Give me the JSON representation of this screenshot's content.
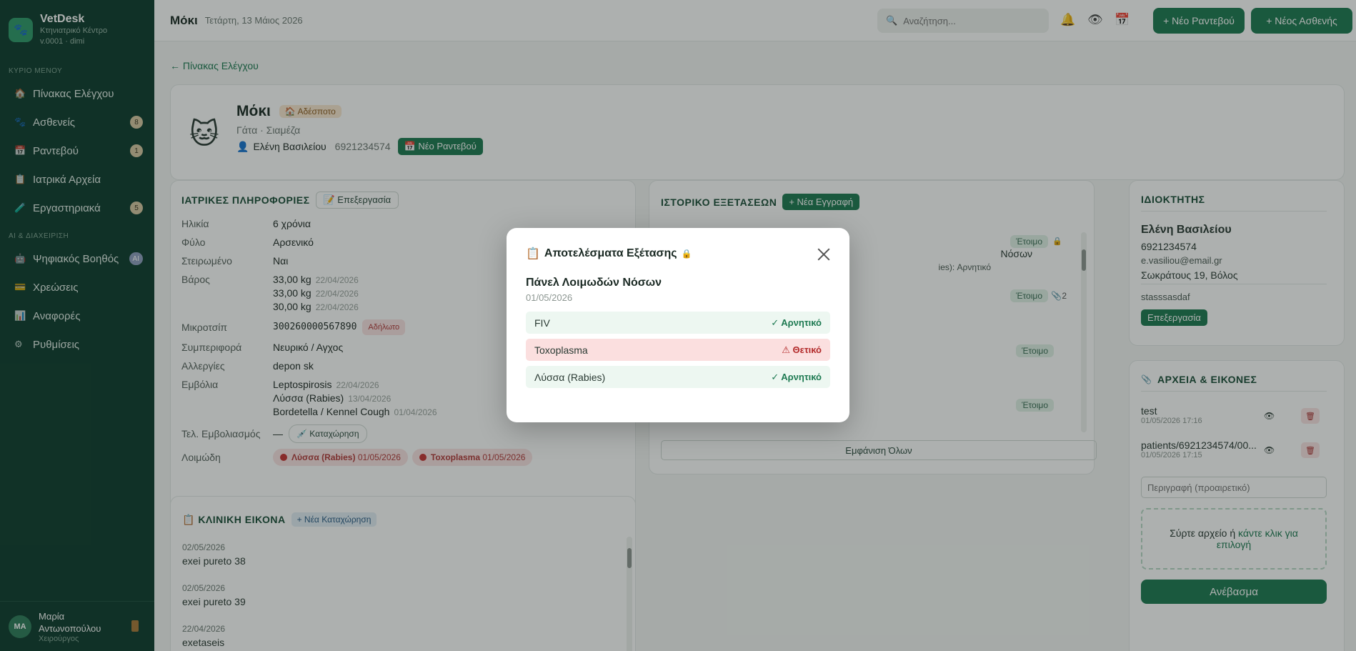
{
  "brand": {
    "name": "VetDesk",
    "subtitle": "Κτηνιατρικό Κέντρο",
    "version": "v.0001 · dimi"
  },
  "sidebar": {
    "section_main": "ΚΥΡΙΟ ΜΕΝΟΥ",
    "section_ai": "AI & ΔΙΑΧΕΙΡΙΣΗ",
    "items": [
      {
        "label": "Πίνακας Ελέγχου",
        "icon": "dashboard-icon"
      },
      {
        "label": "Ασθενείς",
        "icon": "paw-icon",
        "badge": "8"
      },
      {
        "label": "Ραντεβού",
        "icon": "calendar-icon",
        "badge": "1"
      },
      {
        "label": "Ιατρικά Αρχεία",
        "icon": "records-icon"
      },
      {
        "label": "Εργαστηριακά",
        "icon": "lab-icon",
        "badge": "5"
      },
      {
        "label": "Ψηφιακός Βοηθός",
        "icon": "robot-icon",
        "badge": "AI"
      },
      {
        "label": "Χρεώσεις",
        "icon": "card-icon"
      },
      {
        "label": "Αναφορές",
        "icon": "chart-icon"
      },
      {
        "label": "Ρυθμίσεις",
        "icon": "gear-icon"
      }
    ],
    "user": {
      "initials": "MA",
      "name_line1": "Μαρία",
      "name_line2": "Αντωνοπούλου",
      "role": "Χειρούργος"
    }
  },
  "topbar": {
    "title": "Μόκι",
    "date": "Τετάρτη, 13 Μάιος 2026",
    "search_placeholder": "Αναζήτηση...",
    "new_appointment": "+ Νέο Ραντεβού",
    "new_patient": "+ Νέος Ασθενής"
  },
  "back_link": "← Πίνακας Ελέγχου",
  "patient": {
    "name": "Μόκι",
    "status_badge": "🏠 Αδέσποτο",
    "species": "Γάτα · Σιαμέζα",
    "owner": "Ελένη Βασιλείου",
    "phone": "6921234574",
    "new_appointment": "📅 Νέο Ραντεβού"
  },
  "medical": {
    "title": "ΙΑΤΡΙΚΕΣ ΠΛΗΡΟΦΟΡΙΕΣ",
    "edit": "📝 Επεξεργασία",
    "age_label": "Ηλικία",
    "age": "6 χρόνια",
    "sex_label": "Φύλο",
    "sex": "Αρσενικό",
    "neutered_label": "Στειρωμένο",
    "neutered": "Ναι",
    "weight_label": "Βάρος",
    "weights": [
      {
        "value": "33,00 kg",
        "date": "22/04/2026"
      },
      {
        "value": "33,00 kg",
        "date": "22/04/2026"
      },
      {
        "value": "30,00 kg",
        "date": "22/04/2026"
      }
    ],
    "chip_label": "Μικροτσίπ",
    "chip": "300260000567890",
    "chip_status": "Αδήλωτο",
    "behavior_label": "Συμπεριφορά",
    "behavior": "Νευρικό / Αγχος",
    "allergies_label": "Αλλεργίες",
    "allergies": "depon sk",
    "vaccines_label": "Εμβόλια",
    "vaccines": [
      {
        "name": "Leptospirosis",
        "date": "22/04/2026"
      },
      {
        "name": "Λύσσα (Rabies)",
        "date": "13/04/2026"
      },
      {
        "name": "Bordetella / Kennel Cough",
        "date": "01/04/2026"
      }
    ],
    "last_vax_label": "Τελ. Εμβολιασμός",
    "last_vax_value": "—",
    "last_vax_btn": "💉 Καταχώρηση",
    "infections_label": "Λοιμώδη",
    "infections": [
      {
        "name": "Λύσσα (Rabies)",
        "date": "01/05/2026"
      },
      {
        "name": "Toxoplasma",
        "date": "01/05/2026"
      }
    ]
  },
  "history": {
    "title": "ΙΣΤΟΡΙΚΟ ΕΞΕΤΑΣΕΩΝ",
    "new_entry": "+ Νέα Εγγραφή",
    "ready": "Έτοιμο",
    "row1_text": "Νόσων",
    "row1_sub": "ies): Αρνητικό",
    "row2_count": "2",
    "show_all": "Εμφάνιση Όλων"
  },
  "clinical": {
    "title": "📋 ΚΛΙΝΙΚΗ ΕΙΚΟΝΑ",
    "new": "+ Νέα Καταχώρηση",
    "entries": [
      {
        "date": "02/05/2026",
        "text": "exei pureto 38"
      },
      {
        "date": "02/05/2026",
        "text": "exei pureto 39"
      },
      {
        "date": "22/04/2026",
        "text": "exetaseis"
      }
    ]
  },
  "owner": {
    "title": "ΙΔΙΟΚΤΗΤΗΣ",
    "name": "Ελένη Βασιλείου",
    "phone": "6921234574",
    "email": "e.vasiliou@email.gr",
    "address": "Σωκράτους 19, Βόλος",
    "note": "stasssasdaf",
    "edit": "Επεξεργασία"
  },
  "files": {
    "title": "ΑΡΧΕΙΑ & ΕΙΚΟΝΕΣ",
    "items": [
      {
        "name": "test",
        "date": "01/05/2026 17:16"
      },
      {
        "name": "patients/6921234574/00...",
        "date": "01/05/2026 17:15"
      }
    ],
    "desc_placeholder": "Περιγραφή (προαιρετικό)",
    "drop_text": "Σύρτε αρχείο ή ",
    "drop_link": "κάντε κλικ για επιλογή",
    "upload": "Ανέβασμα"
  },
  "modal": {
    "title": "Αποτελέσματα Εξέτασης",
    "panel": "Πάνελ Λοιμωδών Νόσων",
    "date": "01/05/2026",
    "results": [
      {
        "name": "FIV",
        "status": "✓ Αρνητικό",
        "positive": false
      },
      {
        "name": "Toxoplasma",
        "status": "⚠ Θετικό",
        "positive": true
      },
      {
        "name": "Λύσσα (Rabies)",
        "status": "✓ Αρνητικό",
        "positive": false
      }
    ]
  },
  "colors": {
    "sidebar": "#0f3d2e",
    "accent": "#1e7a52",
    "positive": "#b32b2b",
    "negative": "#1e7a52"
  }
}
